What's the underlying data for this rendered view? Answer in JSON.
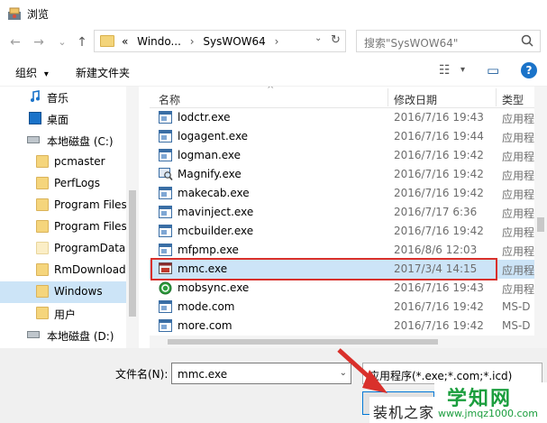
{
  "window": {
    "title": "浏览"
  },
  "nav": {
    "back_glyph": "←",
    "forward_glyph": "→",
    "recent_glyph": "⌄",
    "up_glyph": "↑"
  },
  "address": {
    "prefix": "«",
    "crumbs": [
      "Windo...",
      "SysWOW64"
    ],
    "separator": "›",
    "dropdown_glyph": "⌄",
    "refresh_glyph": "↻"
  },
  "search": {
    "placeholder": "搜索\"SysWOW64\""
  },
  "toolbar": {
    "organize_label": "组织",
    "organize_dd": "▾",
    "new_folder_label": "新建文件夹",
    "view_glyph": "☷",
    "view_dd": "▾",
    "pane_glyph": "▭",
    "help_label": "?"
  },
  "sidebar": {
    "items": [
      {
        "label": "音乐",
        "icon": "music-icon"
      },
      {
        "label": "桌面",
        "icon": "desktop-icon"
      },
      {
        "label": "本地磁盘 (C:)",
        "icon": "drive-icon"
      },
      {
        "label": "pcmaster",
        "icon": "folder-icon"
      },
      {
        "label": "PerfLogs",
        "icon": "folder-icon"
      },
      {
        "label": "Program Files",
        "icon": "folder-icon"
      },
      {
        "label": "Program Files",
        "icon": "folder-icon"
      },
      {
        "label": "ProgramData",
        "icon": "folder-icon"
      },
      {
        "label": "RmDownload",
        "icon": "folder-icon"
      },
      {
        "label": "Windows",
        "icon": "folder-icon",
        "selected": true
      },
      {
        "label": "用户",
        "icon": "folder-icon"
      },
      {
        "label": "本地磁盘 (D:)",
        "icon": "drive-icon"
      }
    ]
  },
  "filelist": {
    "columns": {
      "name": "名称",
      "date": "修改日期",
      "type": "类型"
    },
    "sort_glyph": "^",
    "rows": [
      {
        "name": "lodctr.exe",
        "date": "2016/7/16 19:43",
        "type": "应用程"
      },
      {
        "name": "logagent.exe",
        "date": "2016/7/16 19:44",
        "type": "应用程"
      },
      {
        "name": "logman.exe",
        "date": "2016/7/16 19:42",
        "type": "应用程"
      },
      {
        "name": "Magnify.exe",
        "date": "2016/7/16 19:42",
        "type": "应用程"
      },
      {
        "name": "makecab.exe",
        "date": "2016/7/16 19:42",
        "type": "应用程"
      },
      {
        "name": "mavinject.exe",
        "date": "2016/7/17 6:36",
        "type": "应用程"
      },
      {
        "name": "mcbuilder.exe",
        "date": "2016/7/16 19:42",
        "type": "应用程"
      },
      {
        "name": "mfpmp.exe",
        "date": "2016/8/6 12:03",
        "type": "应用程"
      },
      {
        "name": "mmc.exe",
        "date": "2017/3/4 14:15",
        "type": "应用程",
        "selected": true
      },
      {
        "name": "mobsync.exe",
        "date": "2016/7/16 19:43",
        "type": "应用程"
      },
      {
        "name": "mode.com",
        "date": "2016/7/16 19:42",
        "type": "MS-D"
      },
      {
        "name": "more.com",
        "date": "2016/7/16 19:42",
        "type": "MS-D"
      }
    ]
  },
  "bottom": {
    "filename_label": "文件名(N):",
    "filename_value": "mmc.exe",
    "filetype_value": "应用程序(*.exe;*.com;*.icd)"
  },
  "watermarks": {
    "left_text": "装机之家",
    "right_big": "学知网",
    "right_url": "www.jmqz1000.com"
  },
  "colors": {
    "selection": "#cce4f7",
    "highlight_border": "#d9302b",
    "help_blue": "#1a73c9",
    "watermark_green": "#1b9e3e"
  }
}
